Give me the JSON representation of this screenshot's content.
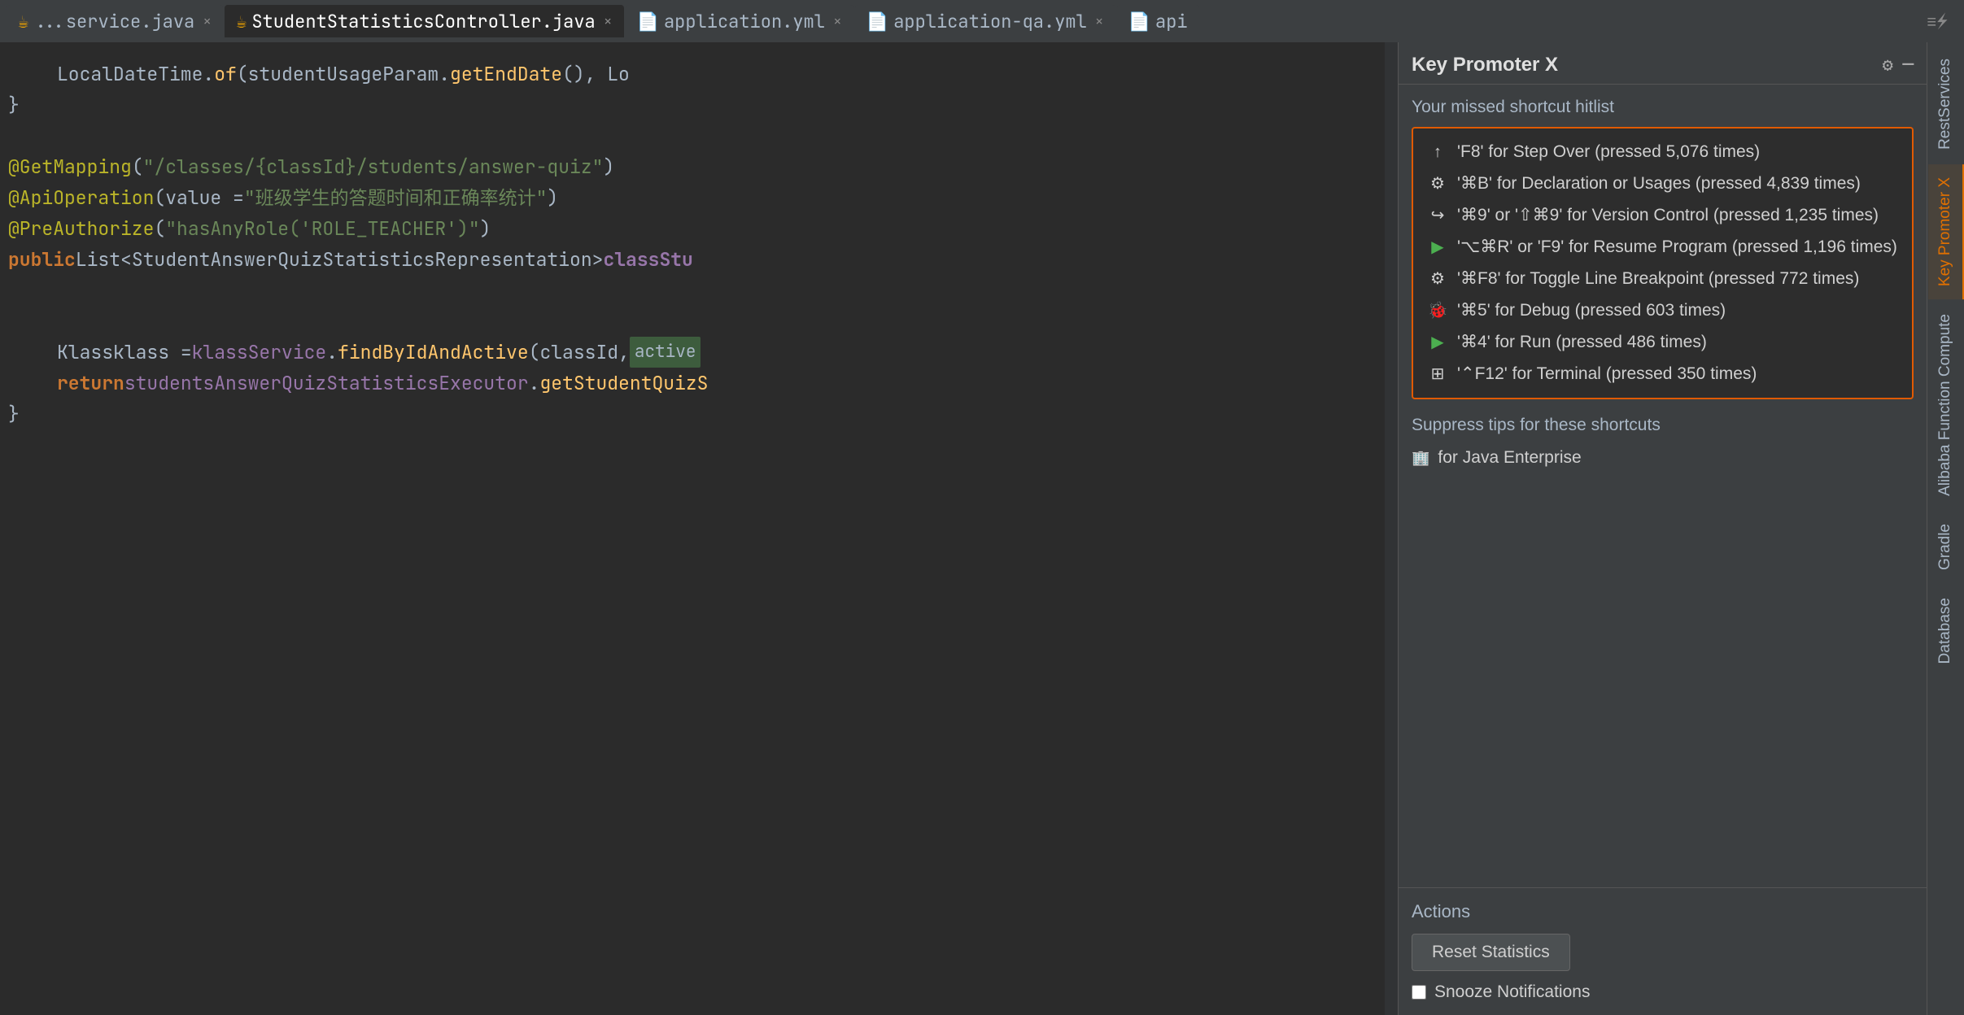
{
  "tabs": [
    {
      "id": "tab-service",
      "label": "...service.java",
      "icon": "☕",
      "active": false,
      "closeable": true
    },
    {
      "id": "tab-controller",
      "label": "StudentStatisticsController.java",
      "icon": "☕",
      "active": true,
      "closeable": true
    },
    {
      "id": "tab-appyml",
      "label": "application.yml",
      "icon": "📄",
      "active": false,
      "closeable": true
    },
    {
      "id": "tab-appqayml",
      "label": "application-qa.yml",
      "icon": "📄",
      "active": false,
      "closeable": true
    },
    {
      "id": "tab-api",
      "label": "api",
      "icon": "📄",
      "active": false,
      "closeable": false
    }
  ],
  "code_lines": [
    {
      "id": 1,
      "content": "    LocalDateTime.of(studentUsageParam.getEndDate(), Lo"
    },
    {
      "id": 2,
      "content": "}"
    },
    {
      "id": 3,
      "content": ""
    },
    {
      "id": 4,
      "content": "@GetMapping(\"/classes/{classId}/students/answer-quiz\")"
    },
    {
      "id": 5,
      "content": "@ApiOperation(value = \"班级学生的答题时间和正确率统计\")"
    },
    {
      "id": 6,
      "content": "@PreAuthorize(\"hasAnyRole('ROLE_TEACHER')\")"
    },
    {
      "id": 7,
      "content": "public List<StudentAnswerQuizStatisticsRepresentation> classStu"
    },
    {
      "id": 8,
      "content": ""
    },
    {
      "id": 9,
      "content": ""
    },
    {
      "id": 10,
      "content": "    Klass klass = klassService.findByIdAndActive(classId,  active"
    },
    {
      "id": 11,
      "content": "    return studentsAnswerQuizStatisticsExecutor.getStudentQuizS"
    },
    {
      "id": 12,
      "content": "}"
    },
    {
      "id": 13,
      "content": ""
    }
  ],
  "kpx": {
    "title": "Key Promoter X",
    "hitlist_title": "Your missed shortcut hitlist",
    "items": [
      {
        "icon": "↑",
        "text": "'F8' for Step Over (pressed 5,076 times)"
      },
      {
        "icon": "⚙",
        "text": "'⌘B' for Declaration or Usages (pressed 4,839 times)"
      },
      {
        "icon": "↪",
        "text": "'⌘9' or '⇧⌘9' for Version Control (pressed 1,235 times)"
      },
      {
        "icon": "▶",
        "text": "'⌥⌘R' or 'F9' for Resume Program (pressed 1,196 times)"
      },
      {
        "icon": "⚙",
        "text": "'⌘F8' for Toggle Line Breakpoint (pressed 772 times)"
      },
      {
        "icon": "🐞",
        "text": "'⌘5' for Debug (pressed 603 times)"
      },
      {
        "icon": "▶",
        "text": "'⌘4' for Run (pressed 486 times)"
      },
      {
        "icon": "⊞",
        "text": "'⌃F12' for Terminal (pressed 350 times)"
      }
    ],
    "suppress_title": "Suppress tips for these shortcuts",
    "suppress_items": [
      {
        "icon": "🏢",
        "text": "for Java Enterprise"
      }
    ],
    "actions_title": "Actions",
    "reset_button": "Reset Statistics",
    "snooze_label": "Snooze Notifications",
    "snooze_checked": false
  },
  "right_tabs": [
    {
      "id": "rest-services",
      "label": "RestServices",
      "icon": "🔗",
      "active": false
    },
    {
      "id": "key-promoter-x",
      "label": "Key Promoter X",
      "icon": "⌨",
      "active": true
    },
    {
      "id": "alibaba",
      "label": "Alibaba Function Compute",
      "icon": "☁",
      "active": false
    },
    {
      "id": "gradle",
      "label": "Gradle",
      "icon": "🐘",
      "active": false
    },
    {
      "id": "database",
      "label": "Database",
      "icon": "🗄",
      "active": false
    }
  ]
}
